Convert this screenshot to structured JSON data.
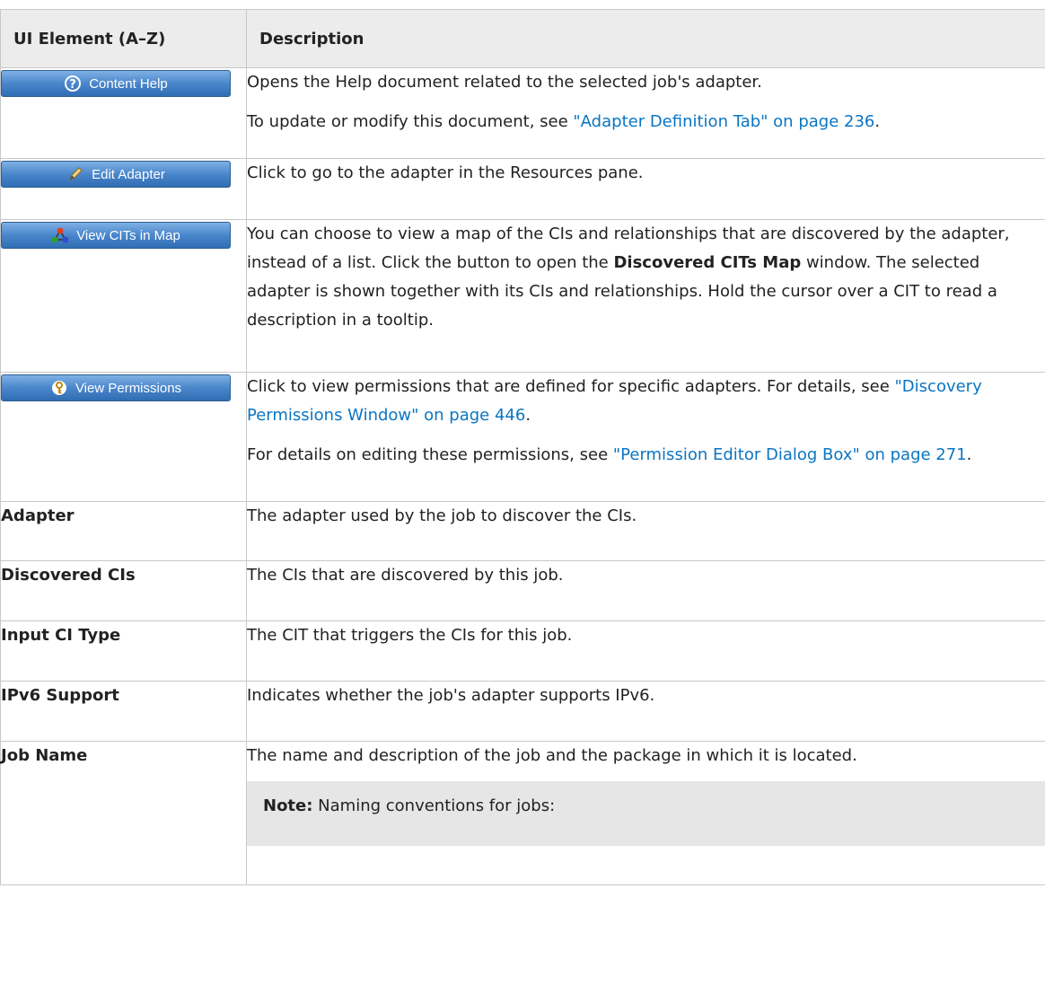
{
  "header": {
    "col1": "UI Element (A–Z)",
    "col2": "Description"
  },
  "rows": [
    {
      "button": {
        "label": "Content Help",
        "icon": "help-icon"
      },
      "paragraphs": [
        {
          "text": "Opens the Help document related to the selected job's adapter."
        },
        {
          "pre": "To update or modify this document, see ",
          "link": "\"Adapter Definition Tab\" on page 236",
          "post": "."
        }
      ]
    },
    {
      "button": {
        "label": "Edit Adapter",
        "icon": "pencil-icon"
      },
      "paragraphs": [
        {
          "text": "Click to go to the adapter in the Resources pane."
        }
      ]
    },
    {
      "button": {
        "label": "View CITs in Map",
        "icon": "map-icon"
      },
      "paragraphs": [
        {
          "pre": "You can choose to view a map of the CIs and relationships that are discovered by the adapter, instead of a list. Click the button to open the ",
          "bold": "Discovered CITs Map",
          "post": " window. The selected adapter is shown together with its CIs and relationships. Hold the cursor over a CIT to read a description in a tooltip."
        }
      ]
    },
    {
      "button": {
        "label": "View Permissions",
        "icon": "key-icon"
      },
      "paragraphs": [
        {
          "pre": "Click to view permissions that are defined for specific adapters. For details, see ",
          "link": "\"Discovery Permissions Window\" on page 446",
          "post": "."
        },
        {
          "pre": "For details on editing these permissions, see ",
          "link": "\"Permission Editor Dialog Box\" on page 271",
          "post": "."
        }
      ]
    },
    {
      "term": "Adapter",
      "text": "The adapter used by the job to discover the CIs."
    },
    {
      "term": "Discovered CIs",
      "text": "The CIs that are discovered by this job."
    },
    {
      "term": "Input CI Type",
      "text": "The CIT that triggers the CIs for this job."
    },
    {
      "term": "IPv6 Support",
      "text": "Indicates whether the job's adapter supports IPv6."
    },
    {
      "term": "Job Name",
      "text": "The name and description of the job and the package in which it is located.",
      "note": {
        "label": "Note:",
        "text": " Naming conventions for jobs:"
      }
    }
  ],
  "colors": {
    "link": "#0a75c2",
    "header_bg": "#ececec",
    "button_top": "#7fb0e4",
    "button_bottom": "#2f6db3",
    "note_bg": "#e6e6e6"
  }
}
